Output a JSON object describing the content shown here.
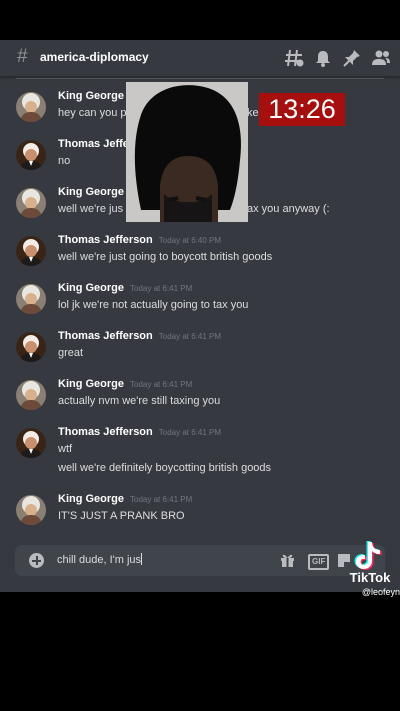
{
  "channel": {
    "hash": "#",
    "name": "america-diplomacy"
  },
  "header_icons": [
    "threads-icon",
    "bell-icon",
    "pin-icon",
    "members-icon"
  ],
  "messages": [
    {
      "author": "King George",
      "time": "",
      "lines": [
        "hey can you p",
        "kes"
      ]
    },
    {
      "author": "Thomas Jeffer",
      "time": "",
      "lines": [
        "no"
      ]
    },
    {
      "author": "King George",
      "time": "",
      "lines": [
        "well we're jus",
        "ax you anyway (:"
      ]
    },
    {
      "author": "Thomas Jefferson",
      "time": "Today at 6:40 PM",
      "lines": [
        "well we're just going to boycott british goods"
      ]
    },
    {
      "author": "King George",
      "time": "Today at 6:41 PM",
      "lines": [
        "lol jk we're not actually going to tax you"
      ]
    },
    {
      "author": "Thomas Jefferson",
      "time": "Today at 6:41 PM",
      "lines": [
        "great"
      ]
    },
    {
      "author": "King George",
      "time": "Today at 6:41 PM",
      "lines": [
        "actually nvm we're still taxing you"
      ]
    },
    {
      "author": "Thomas Jefferson",
      "time": "Today at 6:41 PM",
      "lines": [
        "wtf",
        "well we're definitely boycotting british goods"
      ]
    },
    {
      "author": "King George",
      "time": "Today at 6:41 PM",
      "lines": [
        "IT'S JUST A PRANK BRO"
      ]
    }
  ],
  "composer": {
    "value": "chill dude, I'm jus",
    "gif_label": "GIF"
  },
  "overlay": {
    "clock": "13:26"
  },
  "watermark": {
    "brand": "TikTok",
    "handle": "@leofeyn"
  },
  "colors": {
    "background": "#36393f",
    "composer": "#40444b",
    "clock_bg": "#a70f0f"
  }
}
